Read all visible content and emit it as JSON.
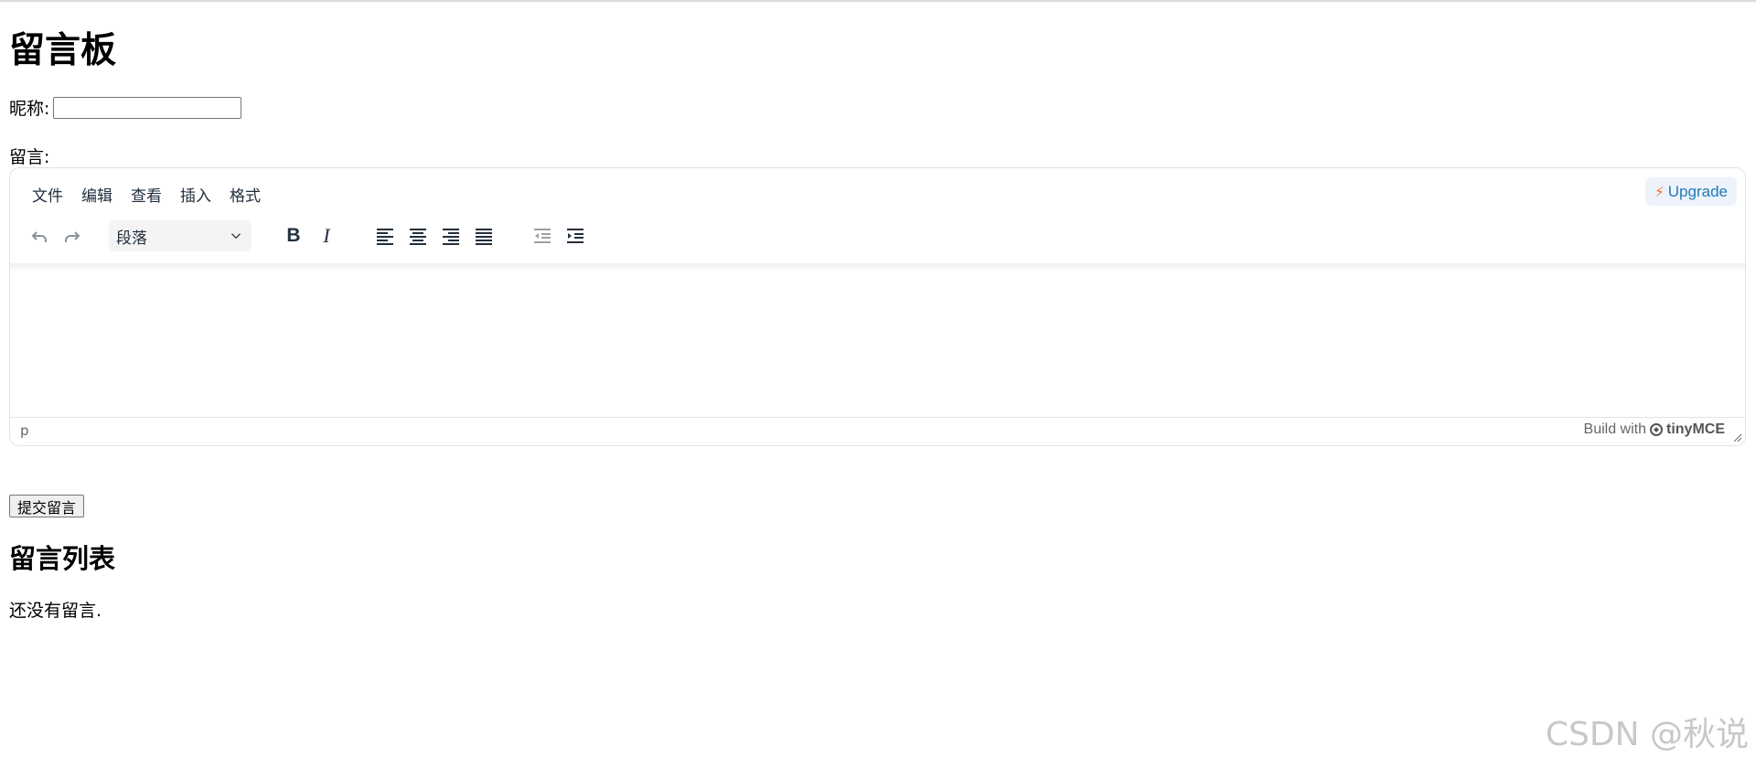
{
  "page": {
    "title": "留言板",
    "nickname_label": "昵称:",
    "nickname_value": "",
    "message_label": "留言:",
    "submit_label": "提交留言",
    "list_title": "留言列表",
    "empty_text": "还没有留言."
  },
  "editor": {
    "menu": [
      "文件",
      "编辑",
      "查看",
      "插入",
      "格式"
    ],
    "upgrade_label": "Upgrade",
    "format_select": "段落",
    "status_path": "p",
    "brand_text": "Build with",
    "brand_name": "tinyMCE",
    "icons": [
      "undo-icon",
      "redo-icon",
      "bold-icon",
      "italic-icon",
      "align-left-icon",
      "align-center-icon",
      "align-right-icon",
      "align-justify-icon",
      "outdent-icon",
      "indent-icon"
    ]
  },
  "watermark": "CSDN @秋说"
}
